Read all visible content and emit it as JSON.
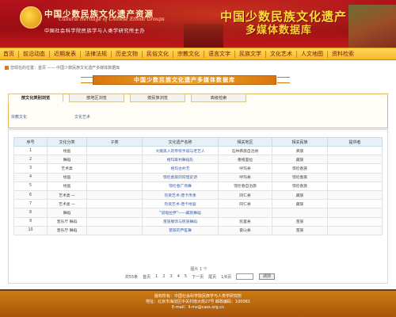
{
  "header": {
    "logo_cn": "中国少数民族文化遗产资源",
    "logo_en_line1": "Cultural Heritage of Chinese Ethnic Groups",
    "logo_sub": "中国社会科学院民族学与人类学研究所主办",
    "banner_line1": "中国少数民族文化遗产",
    "banner_line2": "多媒体数据库"
  },
  "nav": {
    "items": [
      "首页",
      "前沿动态",
      "近期发表",
      "法律法规",
      "历史文物",
      "民俗文化",
      "宗教文化",
      "语言文字",
      "民族文学",
      "文化艺术",
      "人文地图",
      "资料检索"
    ]
  },
  "breadcrumb": "您现在的位置：首页 —— 中国少数民族文化遗产多媒体数据库",
  "section_title": "中国少数民族文化遗产多媒体数据库",
  "tabs": [
    "按文化类别浏览",
    "按地区浏览",
    "按民族浏览",
    "高级检索"
  ],
  "filters": [
    "宗教文化",
    "文化艺术"
  ],
  "table": {
    "headers": [
      "序号",
      "文化分类",
      "子类",
      "文化遗产名称",
      "相关地区",
      "相关民族",
      "提供者"
    ],
    "rows": [
      [
        "1",
        "绘画",
        "",
        "大耀黑人的传统手鼓与老艺人",
        "石林彝族自治县",
        "彝族",
        ""
      ],
      [
        "2",
        "舞蹈",
        "",
        "格玛家村舞蹈队",
        "香格里拉",
        "藏族",
        ""
      ],
      [
        "3",
        "艺术类",
        "",
        "格玛古村艺",
        "呼玛县",
        "鄂伦春族",
        ""
      ],
      [
        "4",
        "绘画",
        "",
        "鄂伦春族的狩猎史诗",
        "呼玛县",
        "鄂伦春族",
        ""
      ],
      [
        "5",
        "绘画",
        "",
        "鄂伦春广场舞",
        "鄂伦春自治旗",
        "鄂伦春族",
        ""
      ],
      [
        "6",
        "艺术类 一",
        "",
        "热贡艺术-唐卡传承",
        "同仁县",
        "藏族",
        ""
      ],
      [
        "7",
        "艺术类 一",
        "",
        "热贡艺术-唐卡绘画",
        "同仁县",
        "藏族",
        ""
      ],
      [
        "8",
        "舞蹈",
        "",
        "\"说唱拉伊\"——藏族舞蹈",
        "",
        "",
        ""
      ],
      [
        "9",
        "音乐厅 舞蹈",
        "",
        "苗族服饰与民族舞蹈",
        "凯里县",
        "苗族",
        ""
      ],
      [
        "10",
        "音乐厅 舞蹈",
        "",
        "苗族的芦笙舞",
        "雷山县",
        "苗族",
        ""
      ]
    ]
  },
  "pagination": {
    "summary": "图片 1 个",
    "total_text": "共55条",
    "first": "首页",
    "pages": [
      "1",
      "2",
      "3",
      "4",
      "5"
    ],
    "next": "下一页",
    "last": "尾页",
    "page_of": "1/6页",
    "go_label": "跳转"
  },
  "footer": {
    "line1": "版权所有：中国社会科学院民族学与人类学研究所",
    "line2": "地址：北京市海淀区中关村南大街27号 邮政编码：100081",
    "line3": "E-mail：ll-mz@cass.org.cn"
  },
  "colors": {
    "header_red": "#b3121b",
    "nav_gold": "#f6b824",
    "accent_orange": "#d8760e",
    "link_blue": "#3a5ea8"
  }
}
